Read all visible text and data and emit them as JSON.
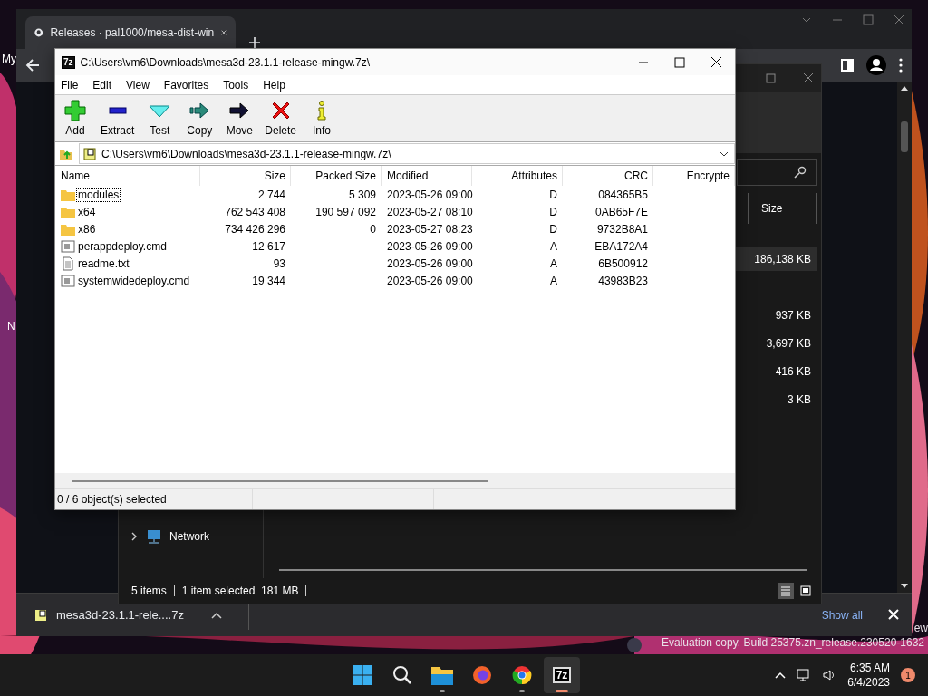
{
  "desktop": {
    "icon_labels": [
      "My",
      "N"
    ],
    "watermark_lines": [
      "ew",
      "Evaluation copy. Build 25375.zn_release.230520-1632"
    ]
  },
  "browser": {
    "tabs": [
      {
        "title": "Releases · pal1000/mesa-dist-win",
        "selected": true
      }
    ],
    "download": {
      "filename": "mesa3d-23.1.1-rele....7z",
      "show_all": "Show all"
    }
  },
  "explorer": {
    "column": "Size",
    "rows": [
      {
        "size": "186,138 KB",
        "selected": true
      },
      {
        "selected": false
      },
      {
        "size": "937 KB",
        "selected": false
      },
      {
        "size": "3,697 KB",
        "selected": false
      },
      {
        "size": "416 KB",
        "selected": false
      },
      {
        "size": "3 KB",
        "selected": false
      }
    ],
    "nav": [
      {
        "label": "Network",
        "expanded": false
      }
    ],
    "status": [
      "5 items",
      "1 item selected  181 MB"
    ]
  },
  "sevenzip": {
    "app_icon": "7z",
    "title": "C:\\Users\\vm6\\Downloads\\mesa3d-23.1.1-release-mingw.7z\\",
    "menu": [
      "File",
      "Edit",
      "View",
      "Favorites",
      "Tools",
      "Help"
    ],
    "toolbar": [
      {
        "label": "Add",
        "kind": "add"
      },
      {
        "label": "Extract",
        "kind": "extract"
      },
      {
        "label": "Test",
        "kind": "test"
      },
      {
        "label": "Copy",
        "kind": "copy"
      },
      {
        "label": "Move",
        "kind": "move"
      },
      {
        "label": "Delete",
        "kind": "delete"
      },
      {
        "label": "Info",
        "kind": "info"
      }
    ],
    "path": "C:\\Users\\vm6\\Downloads\\mesa3d-23.1.1-release-mingw.7z\\",
    "columns": [
      "Name",
      "Size",
      "Packed Size",
      "Modified",
      "Attributes",
      "CRC",
      "Encrypte"
    ],
    "rows": [
      {
        "kind": "folder",
        "focused": true,
        "cells": [
          "modules",
          "2 744",
          "5 309",
          "2023-05-26 09:00",
          "D",
          "084365B5"
        ]
      },
      {
        "kind": "folder",
        "focused": false,
        "cells": [
          "x64",
          "762 543 408",
          "190 597 092",
          "2023-05-27 08:10",
          "D",
          "0AB65F7E"
        ]
      },
      {
        "kind": "folder",
        "focused": false,
        "cells": [
          "x86",
          "734 426 296",
          "0",
          "2023-05-27 08:23",
          "D",
          "9732B8A1"
        ]
      },
      {
        "kind": "script",
        "focused": false,
        "cells": [
          "perappdeploy.cmd",
          "12 617",
          "",
          "2023-05-26 09:00",
          "A",
          "EBA172A4"
        ]
      },
      {
        "kind": "text",
        "focused": false,
        "cells": [
          "readme.txt",
          "93",
          "",
          "2023-05-26 09:00",
          "A",
          "6B500912"
        ]
      },
      {
        "kind": "script",
        "focused": false,
        "cells": [
          "systemwidedeploy.cmd",
          "19 344",
          "",
          "2023-05-26 09:00",
          "A",
          "43983B23"
        ]
      }
    ],
    "status": "0 / 6 object(s) selected"
  },
  "taskbar": {
    "apps": [
      {
        "kind": "start",
        "running": false,
        "active": false
      },
      {
        "kind": "search",
        "running": false,
        "active": false
      },
      {
        "kind": "files",
        "running": true,
        "active": false
      },
      {
        "kind": "firefox",
        "running": false,
        "active": false
      },
      {
        "kind": "chrome",
        "running": true,
        "active": false
      },
      {
        "kind": "sevenzip",
        "label": "7z",
        "running": true,
        "active": true
      }
    ],
    "time": "6:35 AM",
    "date": "6/4/2023",
    "badge": "1"
  }
}
